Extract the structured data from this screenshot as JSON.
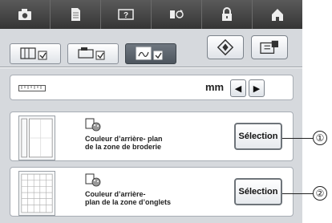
{
  "top_tabs": [
    {
      "icon": "camera-icon"
    },
    {
      "icon": "document-icon"
    },
    {
      "icon": "help-icon"
    },
    {
      "icon": "sewing-settings-icon"
    },
    {
      "icon": "lock-icon"
    },
    {
      "icon": "home-icon"
    }
  ],
  "sub_tabs": [
    {
      "icon": "machine-settings-icon",
      "active": false
    },
    {
      "icon": "display-settings-icon",
      "active": false
    },
    {
      "icon": "embroidery-settings-icon",
      "active": true
    }
  ],
  "unit": {
    "value": "mm"
  },
  "rows": [
    {
      "label_line1": "Couleur d’arrière- plan",
      "label_line2": "de la zone de broderie",
      "button_label": "Sélection",
      "callout": "①"
    },
    {
      "label_line1": "Couleur d’arrière-",
      "label_line2": "plan de la zone d’onglets",
      "button_label": "Sélection",
      "callout": "②"
    }
  ]
}
